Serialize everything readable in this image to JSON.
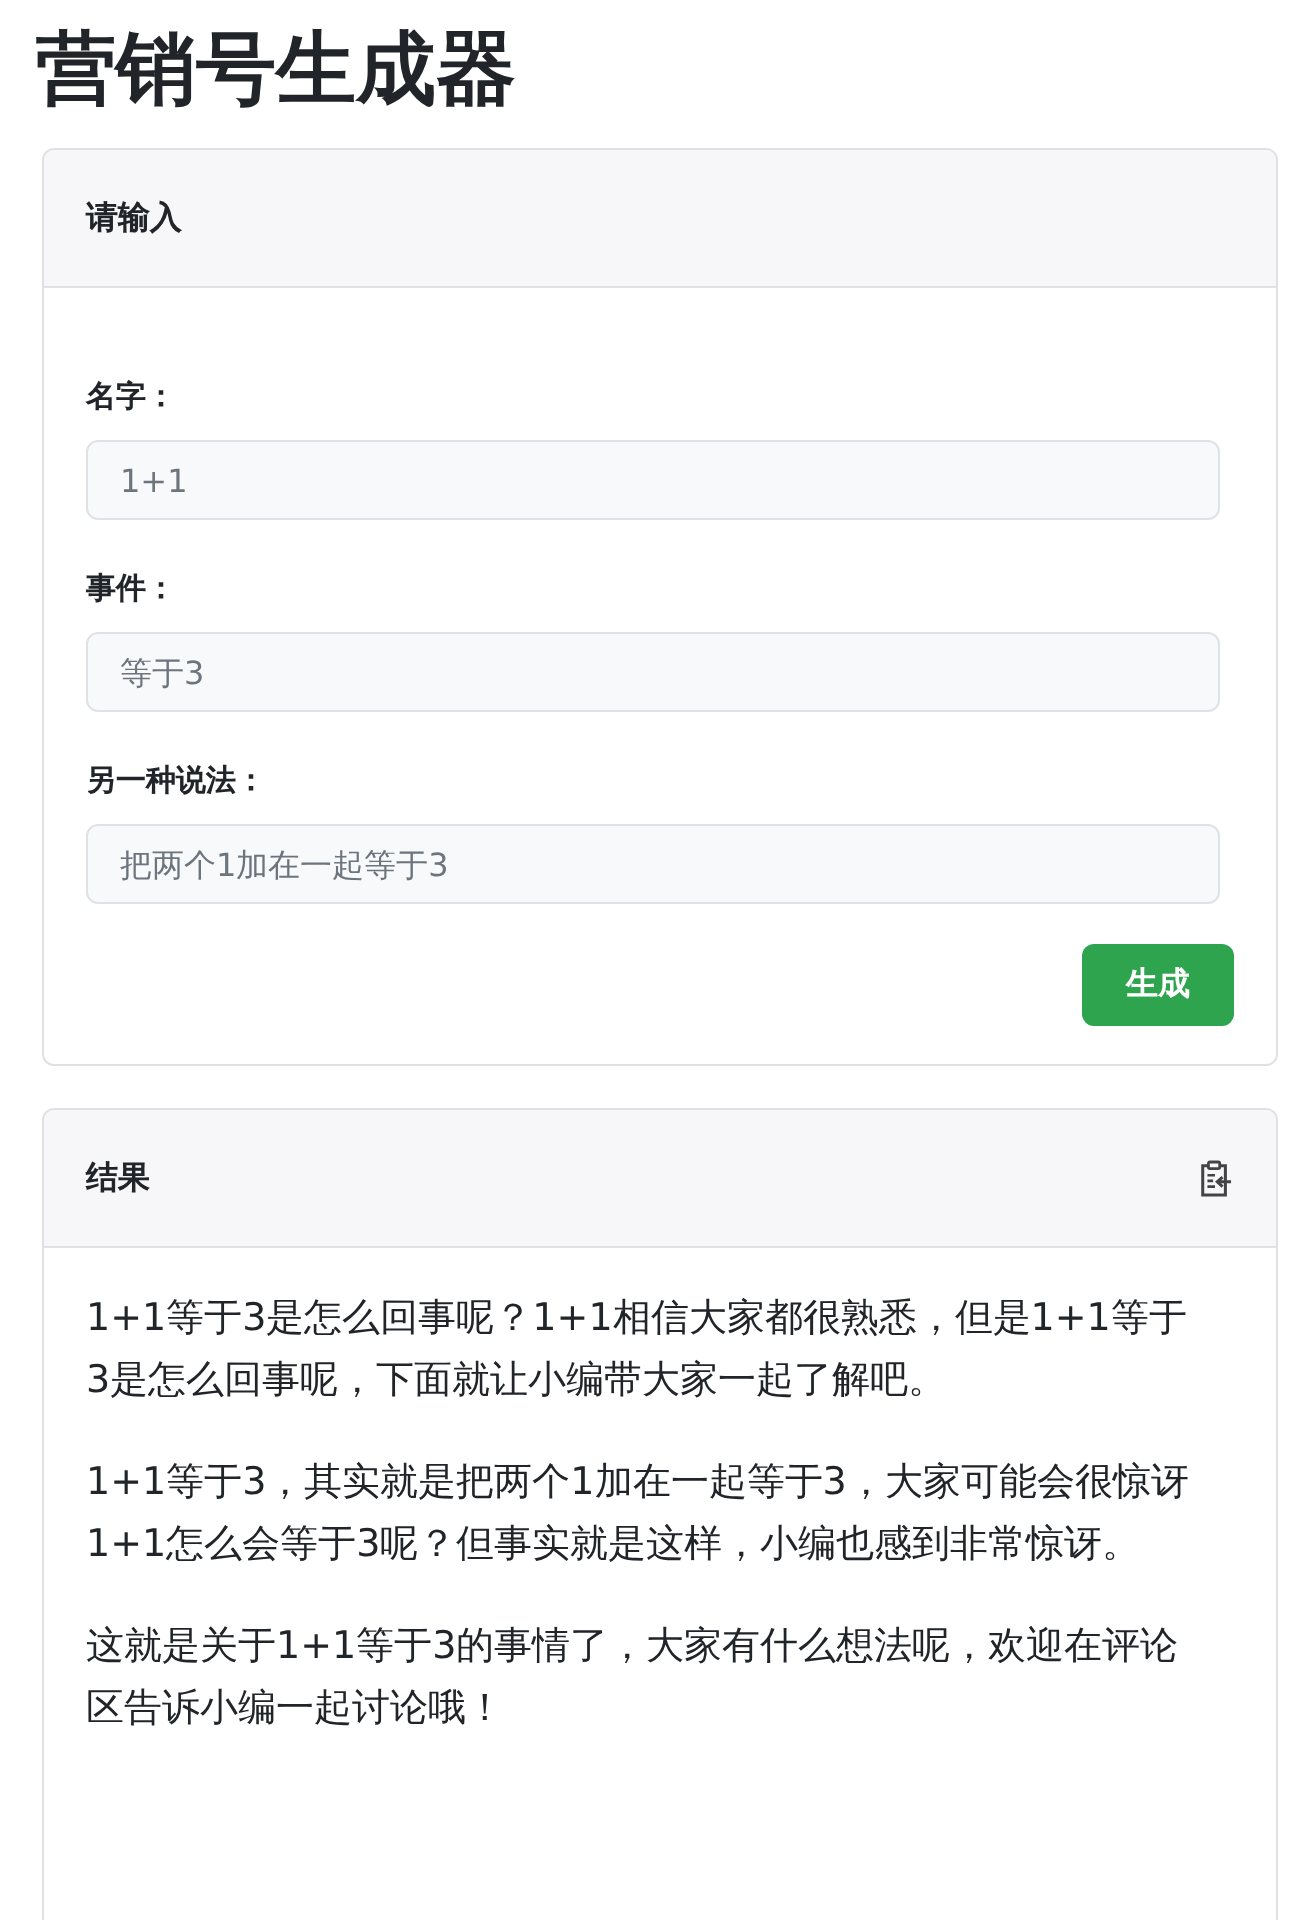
{
  "title": "营销号生成器",
  "input_card": {
    "header": "请输入",
    "fields": [
      {
        "label": "名字：",
        "placeholder": "1+1"
      },
      {
        "label": "事件：",
        "placeholder": "等于3"
      },
      {
        "label": "另一种说法：",
        "placeholder": "把两个1加在一起等于3"
      }
    ],
    "submit_button": "生成"
  },
  "result_card": {
    "header": "结果",
    "paragraphs": [
      "1+1等于3是怎么回事呢？1+1相信大家都很熟悉，但是1+1等于3是怎么回事呢，下面就让小编带大家一起了解吧。",
      "1+1等于3，其实就是把两个1加在一起等于3，大家可能会很惊讶1+1怎么会等于3呢？但事实就是这样，小编也感到非常惊讶。",
      "这就是关于1+1等于3的事情了，大家有什么想法呢，欢迎在评论区告诉小编一起讨论哦！"
    ]
  }
}
